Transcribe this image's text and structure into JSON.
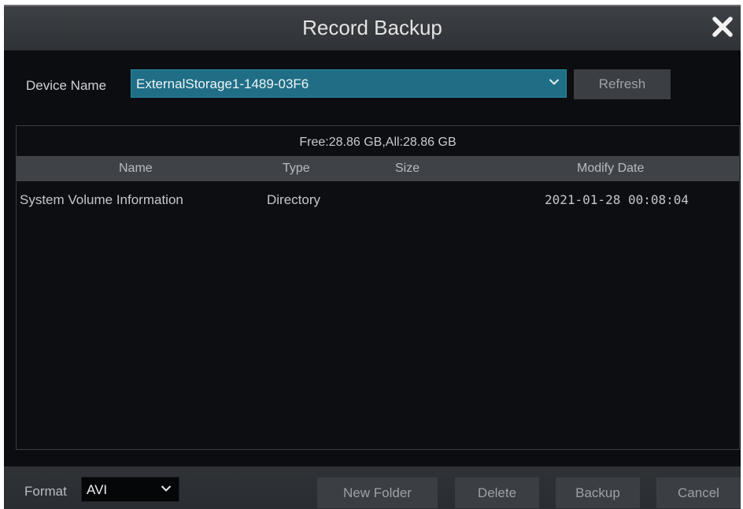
{
  "dialog": {
    "title": "Record Backup"
  },
  "device": {
    "label": "Device Name",
    "selected": "ExternalStorage1-1489-03F6",
    "refresh_label": "Refresh"
  },
  "storage": {
    "space_info": "Free:28.86 GB,All:28.86 GB"
  },
  "table": {
    "columns": [
      "Name",
      "Type",
      "Size",
      "Modify Date"
    ],
    "rows": [
      {
        "name": "System Volume Information",
        "type": "Directory",
        "size": "",
        "modify_date": "2021-01-28 00:08:04"
      }
    ]
  },
  "footer": {
    "format_label": "Format",
    "format_value": "AVI",
    "new_folder_label": "New Folder",
    "delete_label": "Delete",
    "backup_label": "Backup",
    "cancel_label": "Cancel"
  },
  "icons": {
    "close": "close-icon",
    "dropdown": "chevron-down-icon"
  },
  "colors": {
    "accent": "#1f6e86",
    "dialog_bg": "#0b0d10",
    "title_bar": "#35383c",
    "button_bg": "#3b3e42"
  }
}
